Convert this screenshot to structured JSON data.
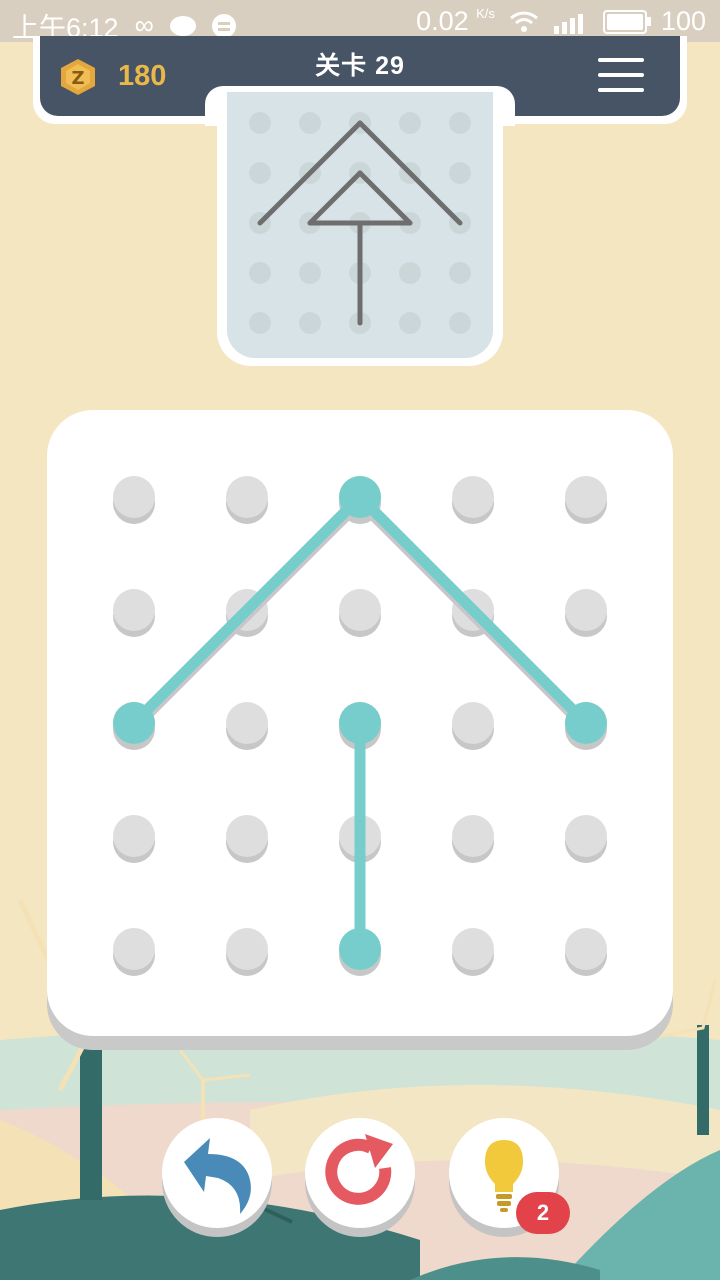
{
  "status_bar": {
    "time": "上午6:12",
    "speed_value": "0.02",
    "speed_unit": "K/s",
    "battery": "100",
    "icons": [
      "infinity-icon",
      "chat-bubble-icon",
      "message-icon",
      "wifi-icon",
      "signal-icon",
      "battery-icon"
    ]
  },
  "header": {
    "coins": "180",
    "level_label": "关卡",
    "level_number": "29",
    "coin_icon": "coin-icon",
    "menu_icon": "hamburger-menu-icon"
  },
  "grid": {
    "rows": 5,
    "cols": 5
  },
  "target_pattern": {
    "segments": [
      [
        [
          2,
          0
        ],
        [
          0,
          2
        ]
      ],
      [
        [
          2,
          0
        ],
        [
          4,
          2
        ]
      ],
      [
        [
          2,
          1
        ],
        [
          1,
          2
        ]
      ],
      [
        [
          2,
          1
        ],
        [
          3,
          2
        ]
      ],
      [
        [
          1,
          2
        ],
        [
          3,
          2
        ]
      ],
      [
        [
          2,
          2
        ],
        [
          2,
          4
        ]
      ]
    ]
  },
  "current_drawing": {
    "active_points": [
      [
        2,
        0
      ],
      [
        0,
        2
      ],
      [
        4,
        2
      ],
      [
        2,
        2
      ],
      [
        2,
        4
      ]
    ],
    "segments": [
      [
        [
          2,
          0
        ],
        [
          0,
          2
        ]
      ],
      [
        [
          2,
          0
        ],
        [
          4,
          2
        ]
      ],
      [
        [
          2,
          2
        ],
        [
          2,
          4
        ]
      ]
    ]
  },
  "buttons": {
    "undo_icon": "undo-arrow-icon",
    "restart_icon": "restart-icon",
    "hint_icon": "lightbulb-icon",
    "hint_count": "2"
  },
  "colors": {
    "background": "#f5e6c2",
    "header": "#475466",
    "coin_text": "#e8b84a",
    "line": "#76cdcb",
    "dot": "#dedede",
    "preview_bg": "#d7e3e6",
    "preview_line": "#6e6e6e",
    "badge": "#e2434b"
  }
}
